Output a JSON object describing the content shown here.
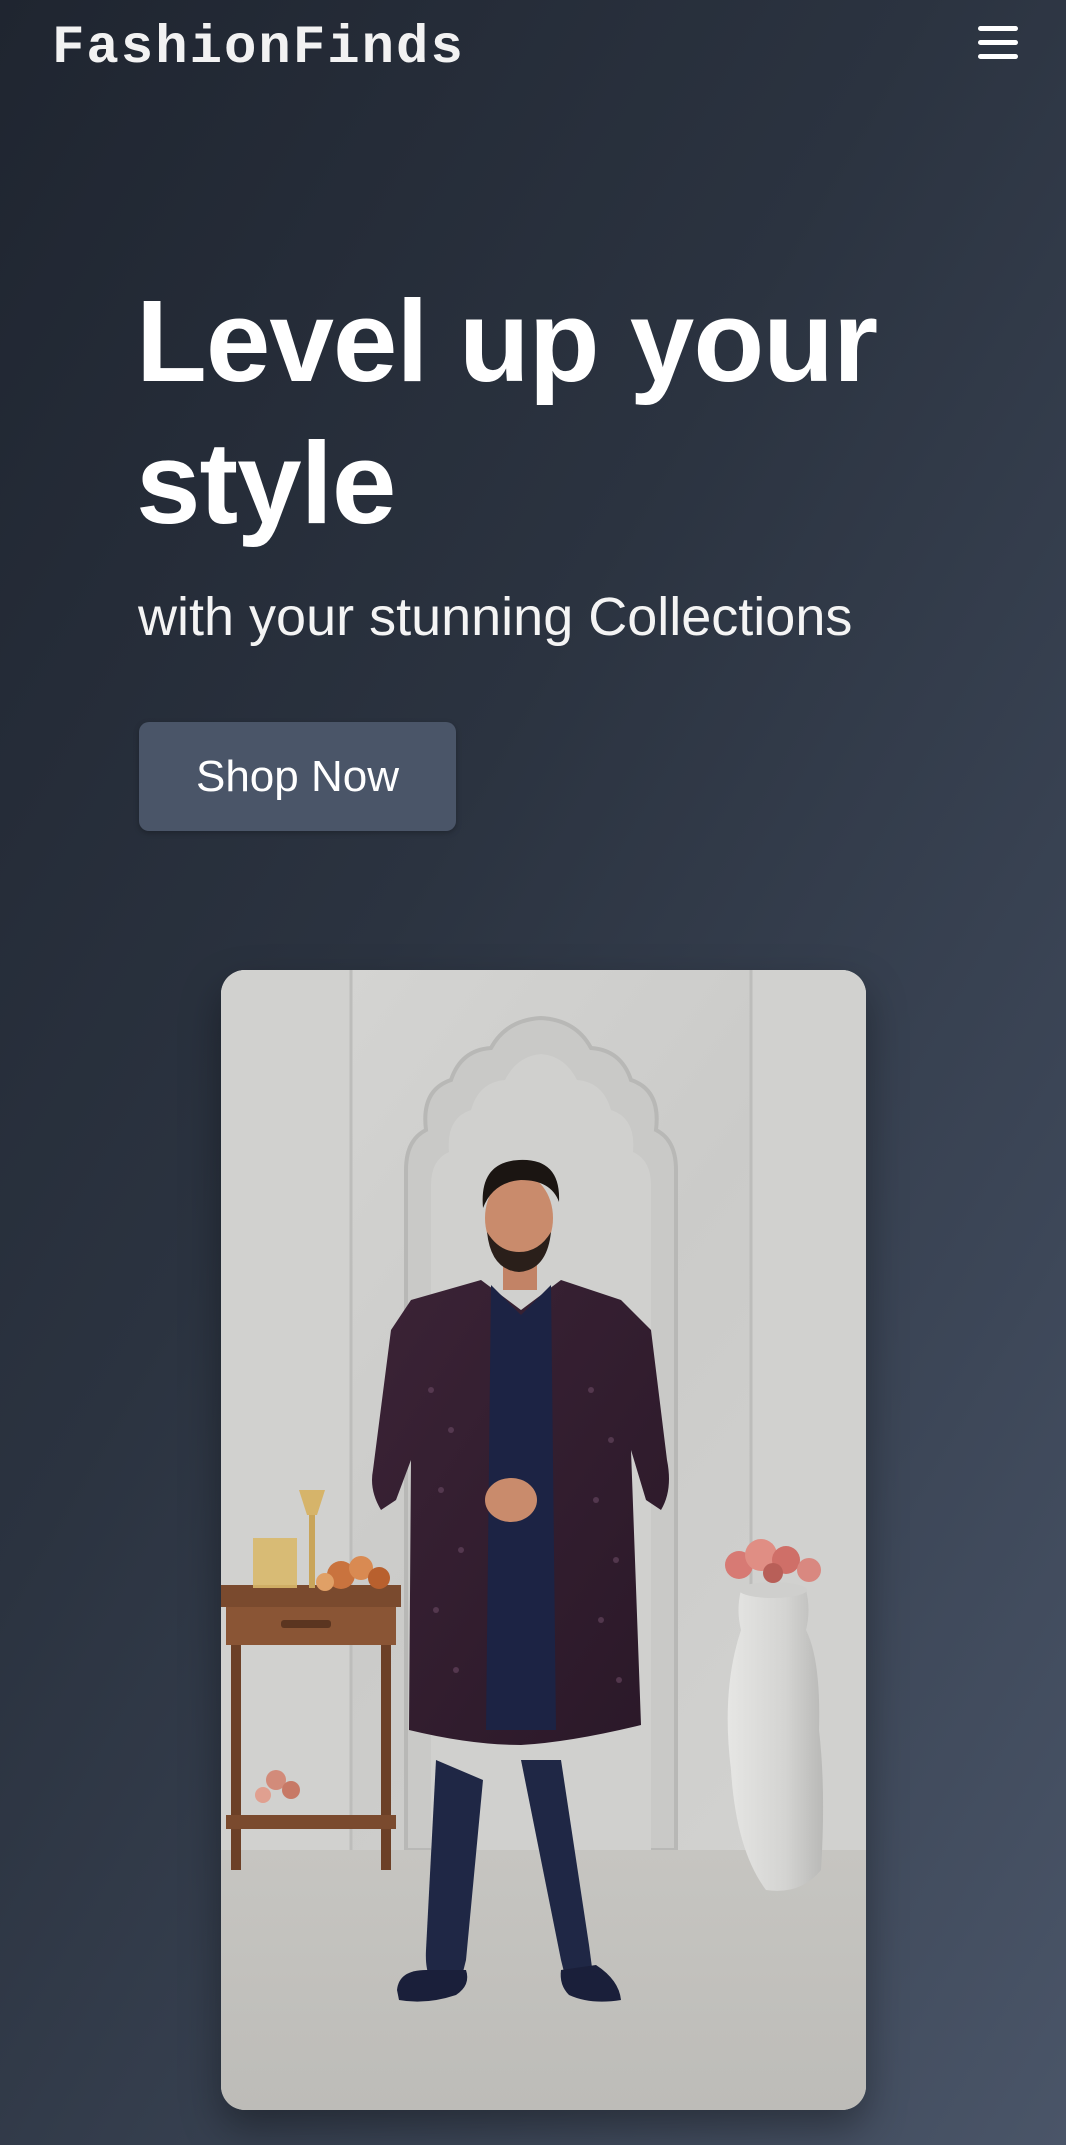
{
  "navbar": {
    "brand": "FashionFinds",
    "menu_icon": "hamburger-menu-icon"
  },
  "hero": {
    "title": "Level up your style",
    "subtitle": "with your stunning Collections",
    "cta_label": "Shop Now"
  },
  "colors": {
    "background_dark": "#1f2530",
    "background_light": "#4a5568",
    "button": "#4a5568",
    "text": "#ffffff"
  }
}
